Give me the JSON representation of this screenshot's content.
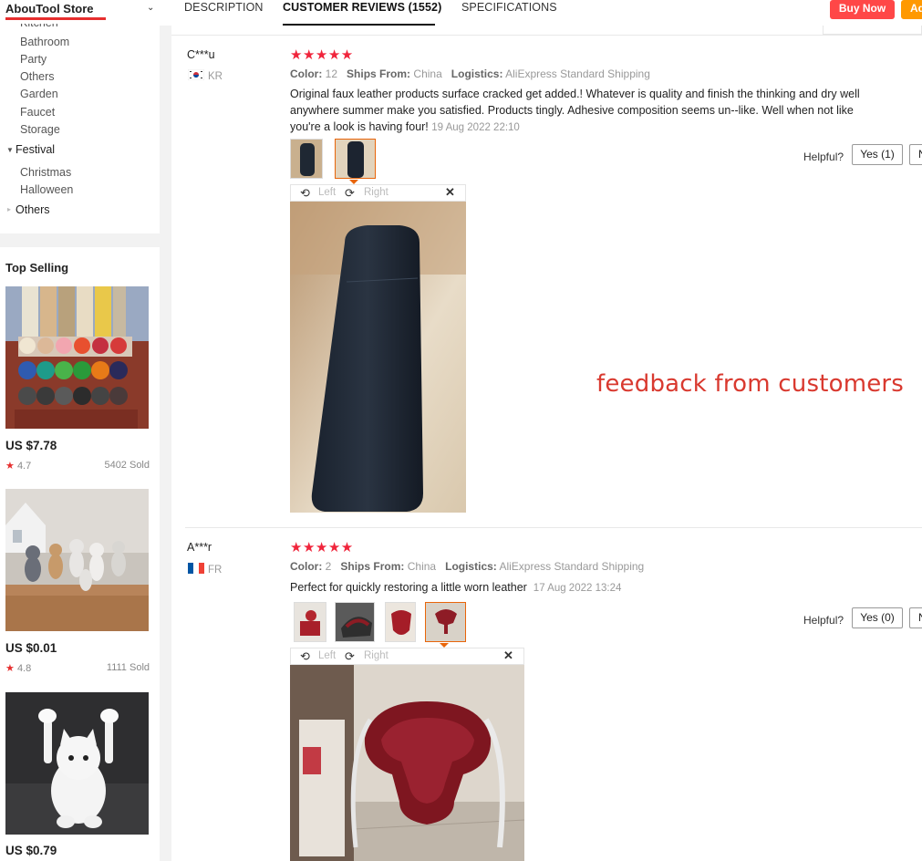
{
  "header": {
    "store_name": "AbouTool Store",
    "tabs": [
      "DESCRIPTION",
      "CUSTOMER REVIEWS (1552)",
      "SPECIFICATIONS"
    ],
    "active_tab": "CUSTOMER REVIEWS (1552)",
    "buy_now": "Buy Now",
    "add_partial": "Ad",
    "accent_color": "#e62e2e"
  },
  "sidebar": {
    "partial_top": "Kitchen",
    "items": [
      "Bathroom",
      "Party",
      "Others",
      "Garden",
      "Faucet",
      "Storage"
    ],
    "group_festival": "Festival",
    "festival_items": [
      "Christmas",
      "Halloween"
    ],
    "group_others": "Others",
    "top_selling_title": "Top Selling",
    "products": [
      {
        "price": "US $7.78",
        "rating": "4.7",
        "sold": "5402 Sold",
        "image": "colored-leather-rolls"
      },
      {
        "price": "US $0.01",
        "rating": "4.8",
        "sold": "1111 Sold",
        "image": "dancing-cat-figurines"
      },
      {
        "price": "US $0.79",
        "image": "cat-earbud-holder"
      }
    ]
  },
  "reviews": [
    {
      "name": "C***u",
      "country": "KR",
      "stars": "★★★★★",
      "color_label": "Color:",
      "color": "12",
      "ships_label": "Ships From:",
      "ships": "China",
      "logistics_label": "Logistics:",
      "logistics": "AliExpress Standard Shipping",
      "text": "Original faux leather products surface cracked get added.! Whatever is quality and finish the thinking and dry well anywhere summer make you satisfied. Products tingly. Adhesive composition seems un--like. Well when not like you're a look is having four!",
      "date": "19 Aug 2022 22:10",
      "helpful": "Helpful?",
      "yes": "Yes (1)",
      "no": "N"
    },
    {
      "name": "A***r",
      "country": "FR",
      "stars": "★★★★★",
      "color_label": "Color:",
      "color": "2",
      "ships_label": "Ships From:",
      "ships": "China",
      "logistics_label": "Logistics:",
      "logistics": "AliExpress Standard Shipping",
      "text": "Perfect for quickly restoring a little worn leather",
      "date": "17 Aug 2022 13:24",
      "helpful": "Helpful?",
      "yes": "Yes (0)",
      "no": "N"
    }
  ],
  "viewer": {
    "left": "Left",
    "right": "Right",
    "rotate_left_icon": "rotate-left-icon",
    "rotate_right_icon": "rotate-right-icon",
    "close_icon": "close-icon"
  },
  "overlay_caption": "feedback from customers"
}
